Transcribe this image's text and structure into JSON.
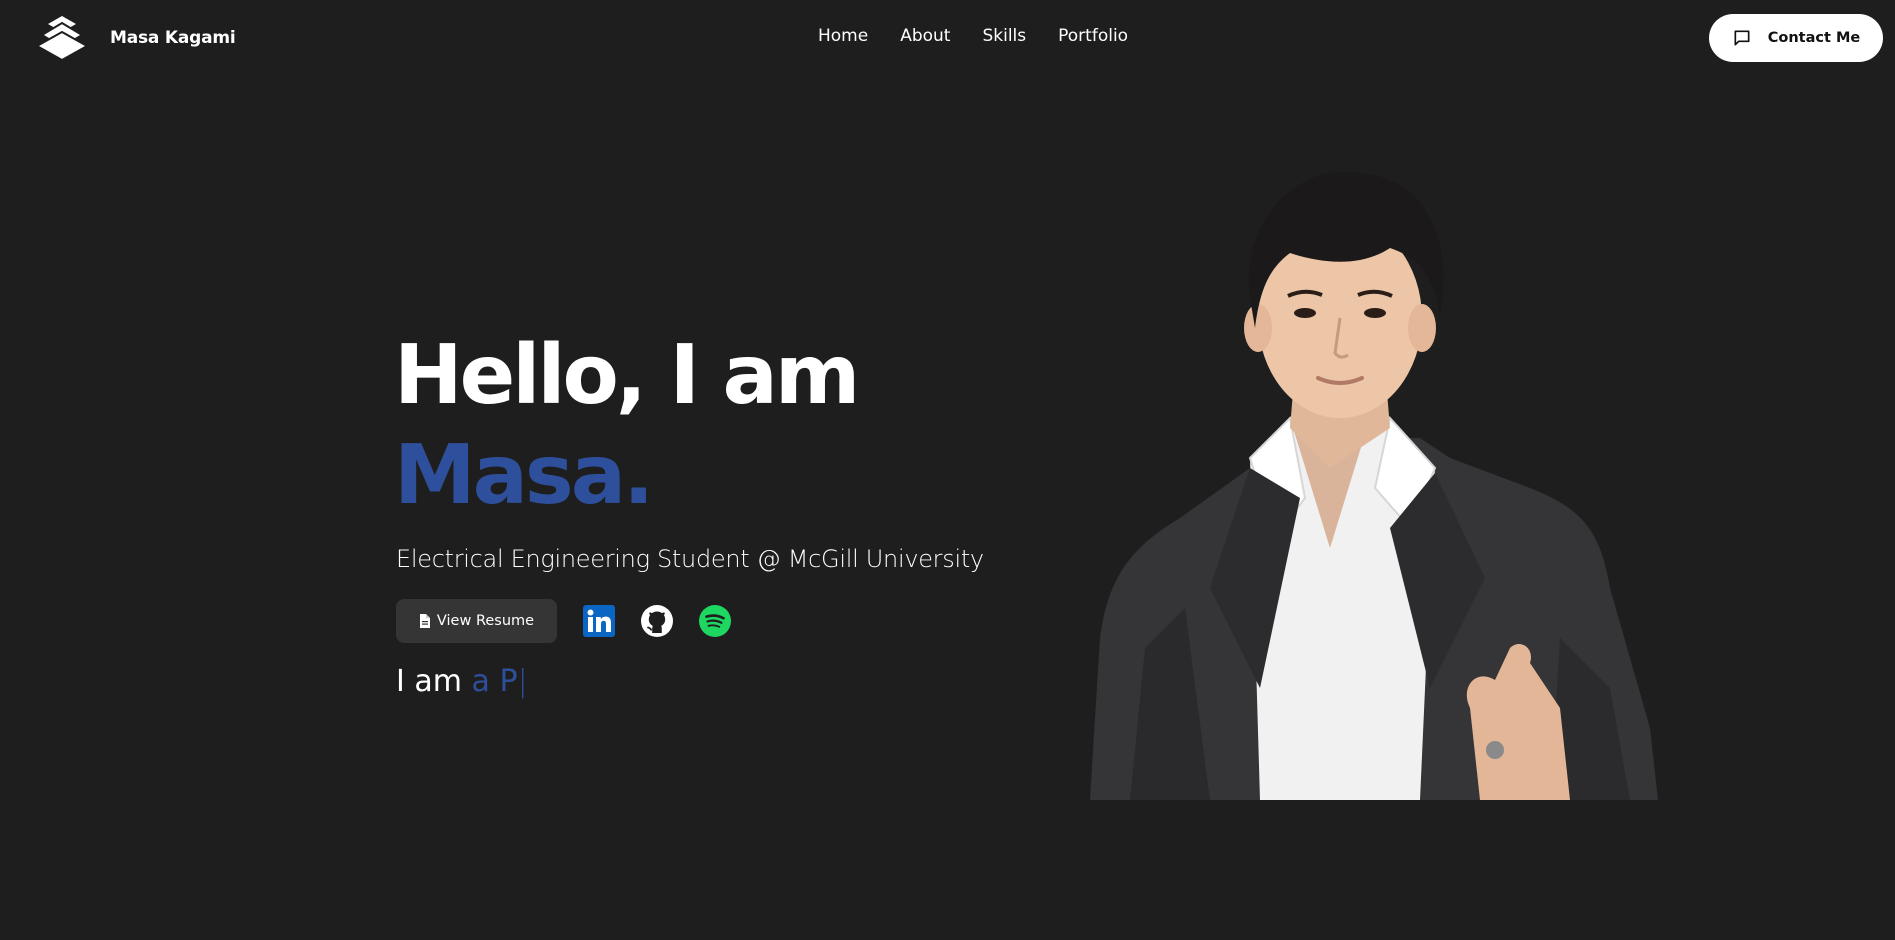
{
  "brand": {
    "name": "Masa Kagami",
    "logo_icon": "layered-stack-icon"
  },
  "nav": {
    "items": [
      {
        "label": "Home"
      },
      {
        "label": "About"
      },
      {
        "label": "Skills"
      },
      {
        "label": "Portfolio"
      }
    ]
  },
  "header": {
    "contact_label": "Contact Me",
    "contact_icon": "message-square-icon"
  },
  "hero": {
    "greeting": "Hello, I am",
    "name": "Masa.",
    "subtitle": "Electrical Engineering Student @ McGill University",
    "resume_label": "View Resume",
    "social": [
      {
        "name": "linkedin",
        "icon": "linkedin-icon"
      },
      {
        "name": "github",
        "icon": "github-icon"
      },
      {
        "name": "spotify",
        "icon": "spotify-icon"
      }
    ],
    "typing_prefix": "I am",
    "typing_text": "a P",
    "typing_cursor": "|"
  },
  "colors": {
    "background": "#1e1e1e",
    "accent": "#2e4f9b",
    "resume_button": "#353535",
    "linkedin": "#0a66c2",
    "spotify": "#1ed760"
  }
}
